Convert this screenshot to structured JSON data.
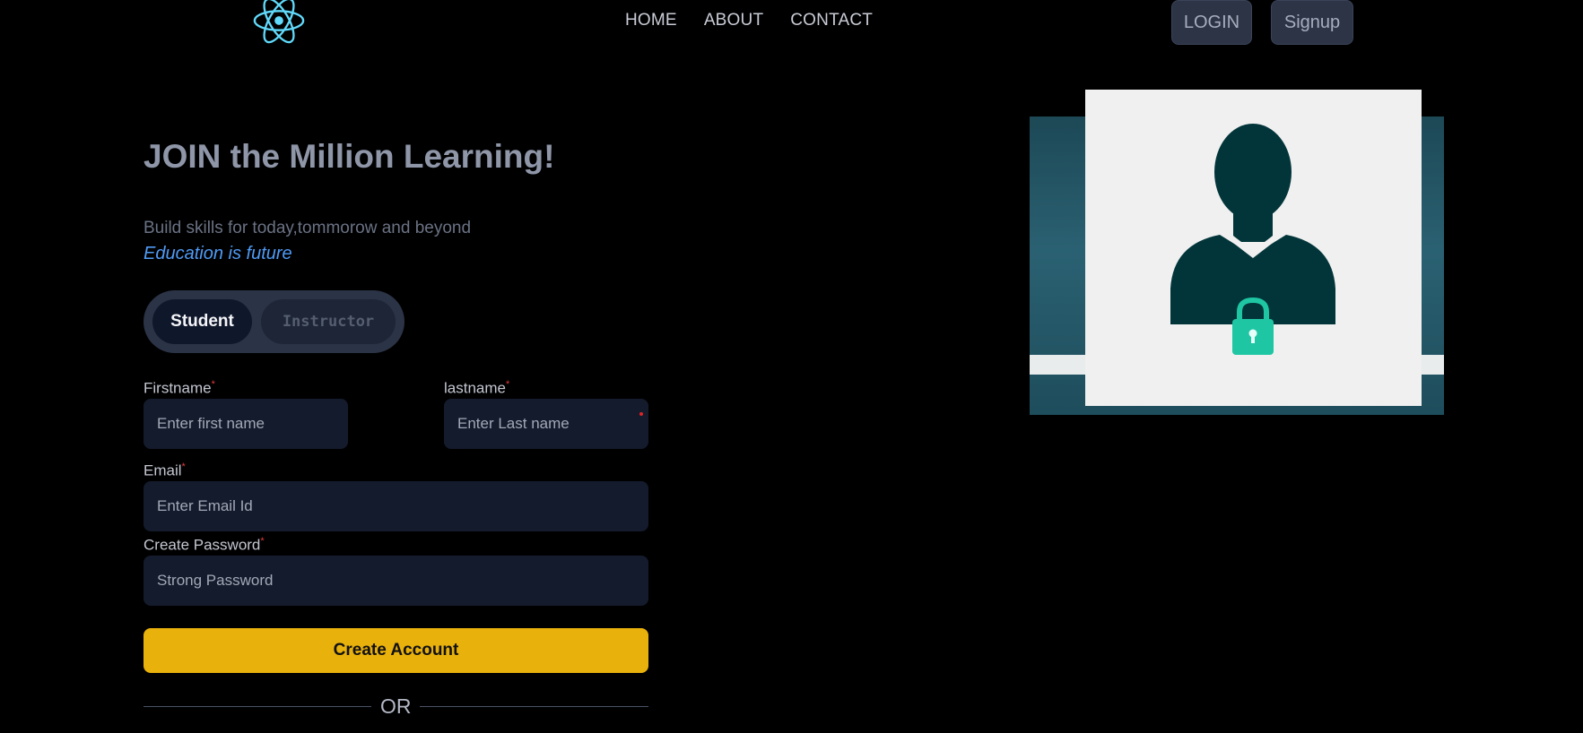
{
  "nav": {
    "logo_icon": "react-atom-icon",
    "links": [
      "HOME",
      "ABOUT",
      "CONTACT"
    ],
    "login_label": "LOGIN",
    "signup_label": "Signup"
  },
  "hero": {
    "title": "JOIN the Million Learning!",
    "subtitle": "Build skills for today,tommorow and beyond",
    "tagline": "Education is future"
  },
  "account_type": {
    "options": [
      "Student",
      "Instructor"
    ],
    "selected": "Student"
  },
  "form": {
    "firstname": {
      "label": "Firstname",
      "required_mark": "*",
      "placeholder": "Enter first name",
      "value": ""
    },
    "lastname": {
      "label": "lastname",
      "required_mark": "*",
      "placeholder": "Enter Last name",
      "value": ""
    },
    "email": {
      "label": "Email",
      "required_mark": "*",
      "placeholder": "Enter Email Id",
      "value": ""
    },
    "password": {
      "label": "Create Password",
      "required_mark": "*",
      "placeholder": "Strong Password",
      "value": ""
    },
    "submit_label": "Create Account",
    "divider_text": "OR"
  },
  "illustration": {
    "icon": "user-lock-icon"
  },
  "colors": {
    "accent_yellow": "#e9b10b",
    "tagline_blue": "#4f9bf6",
    "input_bg": "#141b2c",
    "background": "#000000"
  }
}
